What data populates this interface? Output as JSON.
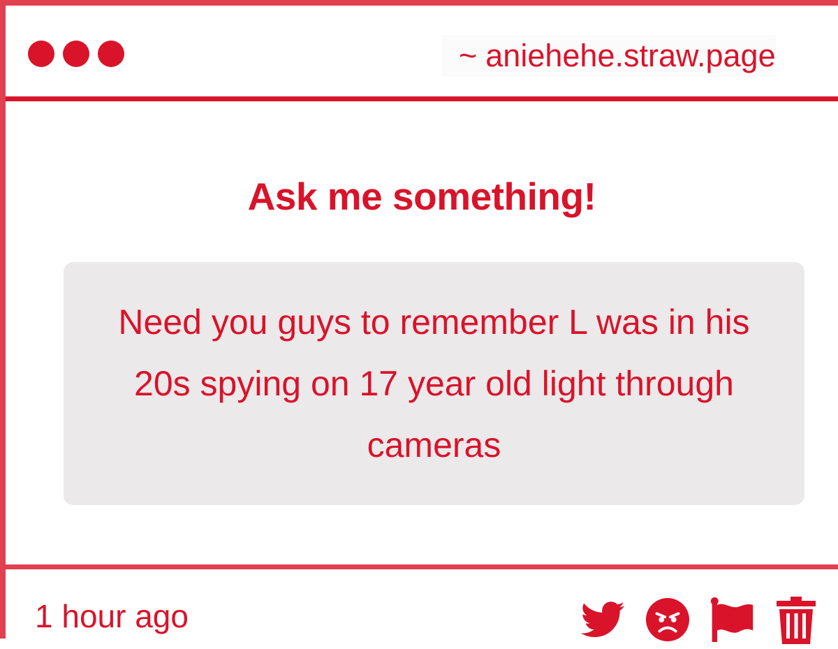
{
  "window": {
    "url": "aniehehe.straw.page",
    "url_prefix": "~"
  },
  "main": {
    "heading": "Ask me something!",
    "question": "Need you guys to remember L was in his 20s spying on 17 year old light through cameras"
  },
  "footer": {
    "timestamp": "1 hour ago",
    "actions": [
      "twitter-icon",
      "angry-face-icon",
      "flag-icon",
      "trash-icon"
    ]
  },
  "colors": {
    "accent": "#d9132a",
    "border": "#e0404f",
    "box": "#ebe9ea"
  }
}
